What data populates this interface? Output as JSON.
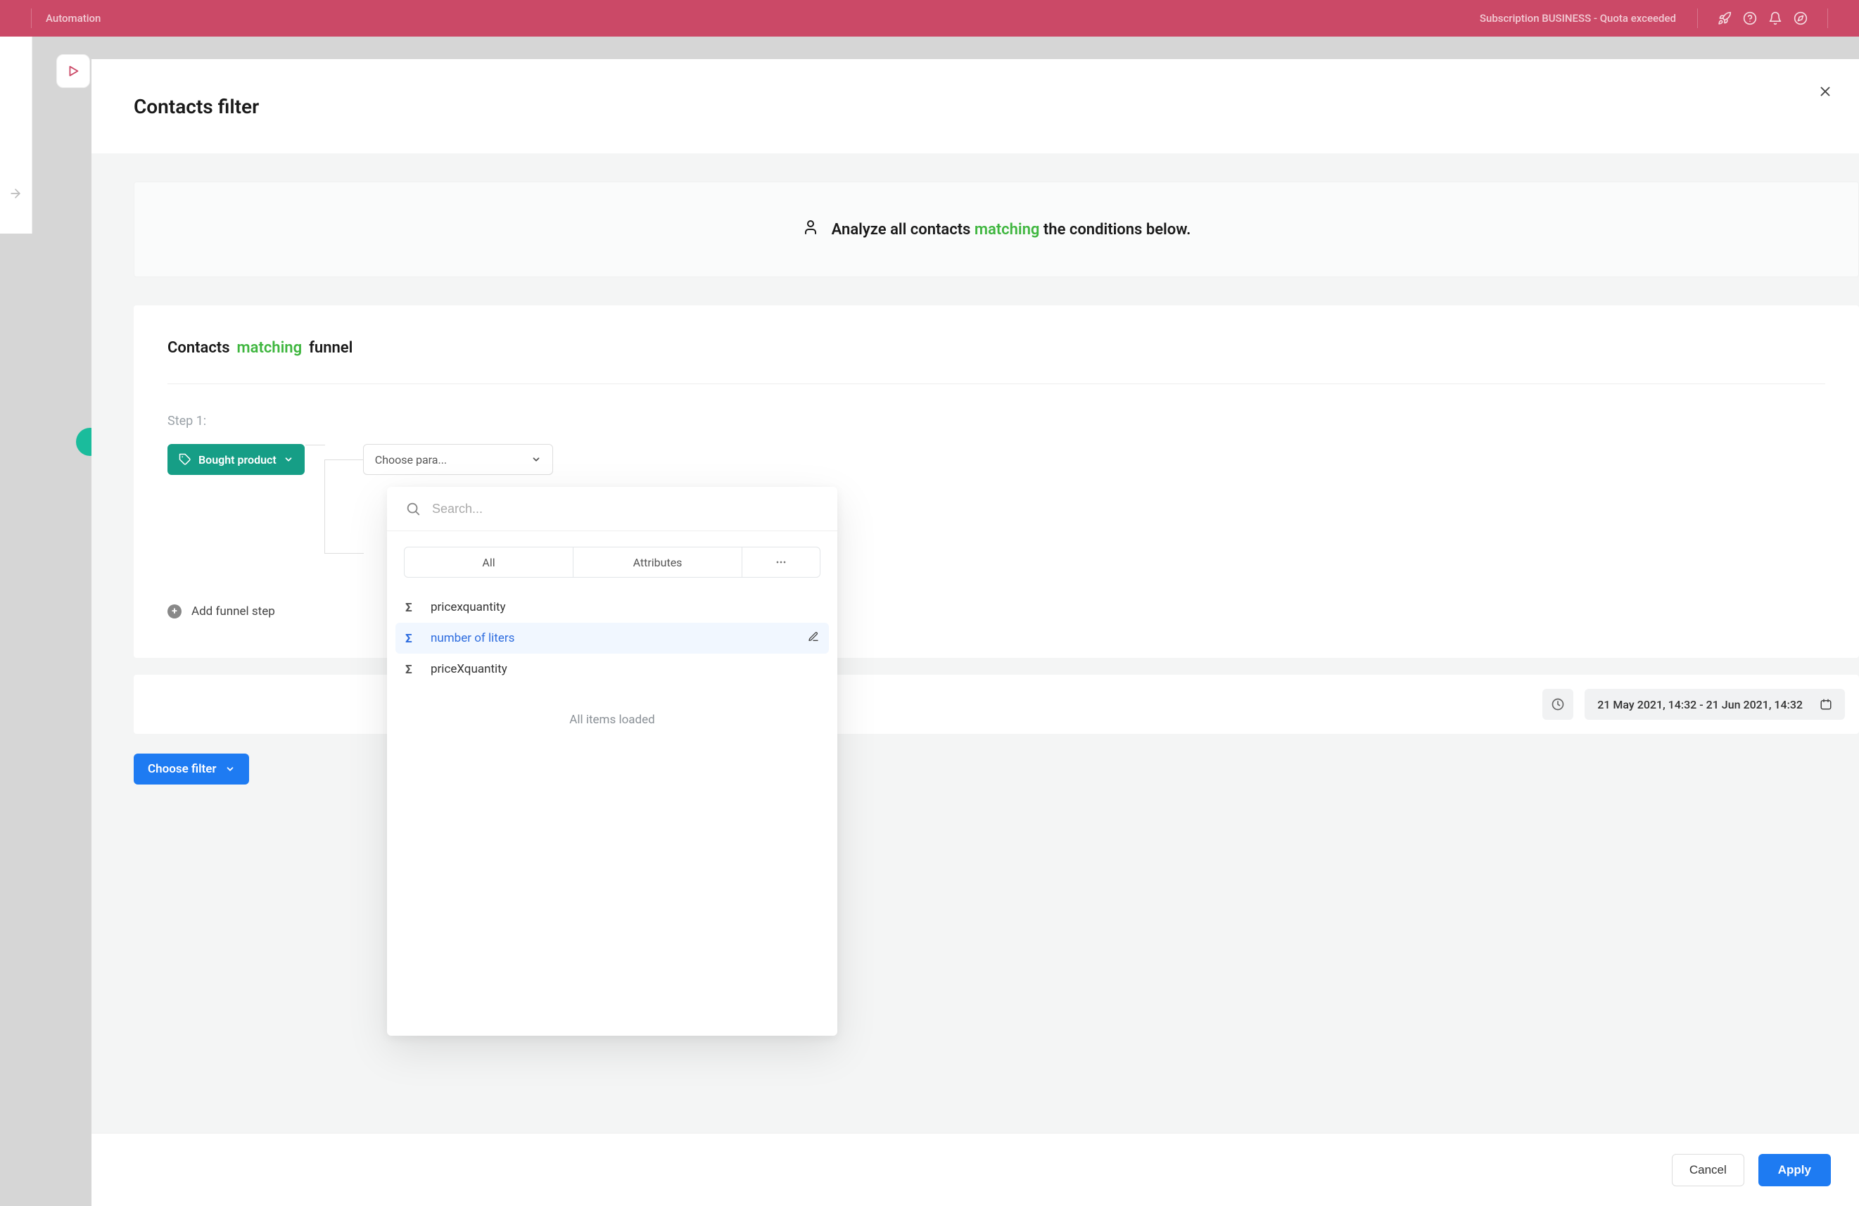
{
  "topbar": {
    "title": "Automation",
    "subscription": "Subscription BUSINESS - Quota exceeded"
  },
  "modal": {
    "title": "Contacts filter",
    "banner": {
      "prefix": "Analyze all contacts",
      "matching": "matching",
      "suffix": "the conditions below."
    },
    "funnel": {
      "title_prefix": "Contacts",
      "title_matching": "matching",
      "title_suffix": "funnel",
      "step_label": "Step 1:",
      "chip_label": "Bought product",
      "choose_param_label": "Choose para...",
      "add_step_label": "Add funnel step"
    },
    "dropdown": {
      "search_placeholder": "Search...",
      "tabs": {
        "all": "All",
        "attributes": "Attributes"
      },
      "items": [
        {
          "label": "pricexquantity",
          "selected": false
        },
        {
          "label": "number of liters",
          "selected": true
        },
        {
          "label": "priceXquantity",
          "selected": false
        }
      ],
      "loaded_text": "All items loaded"
    },
    "date": {
      "range": "21 May 2021, 14:32 - 21 Jun 2021, 14:32"
    },
    "choose_filter": "Choose filter",
    "footer": {
      "cancel": "Cancel",
      "apply": "Apply"
    }
  }
}
